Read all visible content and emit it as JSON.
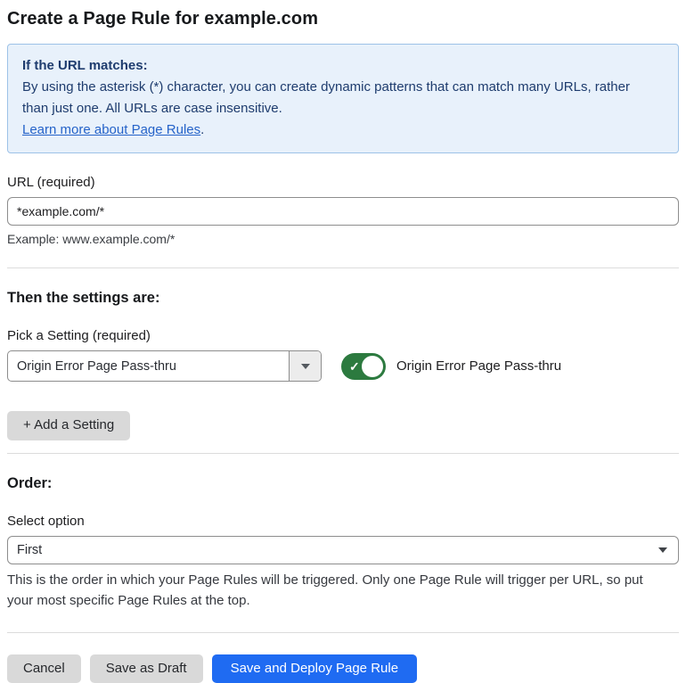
{
  "page": {
    "title": "Create a Page Rule for example.com"
  },
  "info_box": {
    "heading": "If the URL matches:",
    "body": "By using the asterisk (*) character, you can create dynamic patterns that can match many URLs, rather than just one. All URLs are case insensitive.",
    "link_label": "Learn more about Page Rules",
    "link_suffix": "."
  },
  "url_field": {
    "label": "URL (required)",
    "value": "*example.com/*",
    "hint": "Example: www.example.com/*"
  },
  "settings": {
    "heading": "Then the settings are:",
    "picker_label": "Pick a Setting (required)",
    "picker_value": "Origin Error Page Pass-thru",
    "toggle_label": "Origin Error Page Pass-thru",
    "toggle_state": "on",
    "toggle_check_glyph": "✓",
    "add_button_label": "+ Add a Setting"
  },
  "order": {
    "heading": "Order:",
    "select_label": "Select option",
    "select_value": "First",
    "description": "This is the order in which your Page Rules will be triggered. Only one Page Rule will trigger per URL, so put your most specific Page Rules at the top."
  },
  "footer": {
    "cancel_label": "Cancel",
    "save_draft_label": "Save as Draft",
    "save_deploy_label": "Save and Deploy Page Rule"
  },
  "colors": {
    "info_bg": "#e8f1fb",
    "info_border": "#9dc2e7",
    "info_text": "#1e3c6e",
    "link": "#2563c9",
    "toggle_on": "#2c7a3f",
    "primary_button": "#1f6bf2",
    "secondary_button": "#d9d9d9"
  }
}
